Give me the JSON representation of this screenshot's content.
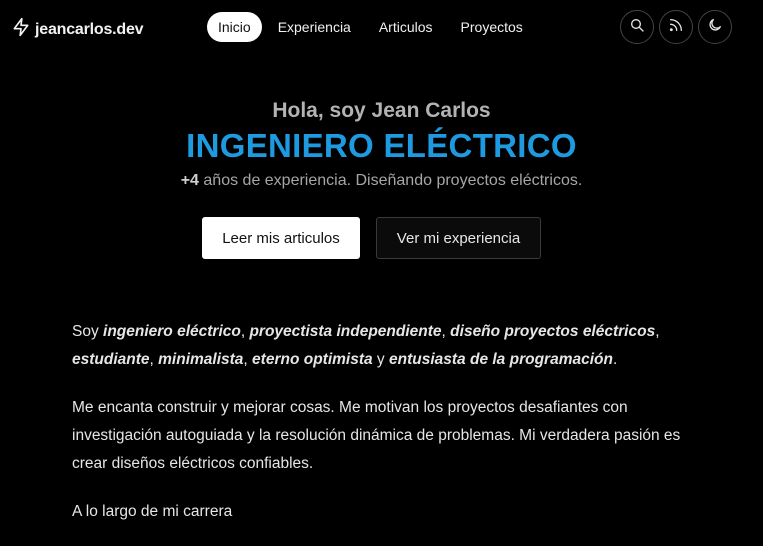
{
  "header": {
    "brand": "jeancarlos.dev",
    "nav": [
      {
        "label": "Inicio",
        "active": true
      },
      {
        "label": "Experiencia",
        "active": false
      },
      {
        "label": "Articulos",
        "active": false
      },
      {
        "label": "Proyectos",
        "active": false
      }
    ],
    "icons": [
      "search-icon",
      "rss-icon",
      "moon-icon"
    ]
  },
  "hero": {
    "greeting": "Hola, soy Jean Carlos",
    "title": "INGENIERO ELÉCTRICO",
    "sub_bold": "+4",
    "sub_rest": " años de experiencia. Diseñando proyectos eléctricos.",
    "primary_button": "Leer mis articulos",
    "secondary_button": "Ver mi experiencia"
  },
  "about": {
    "p1": {
      "t0": "Soy ",
      "e1": "ingeniero eléctrico",
      "t1": ", ",
      "e2": "proyectista independiente",
      "t2": ", ",
      "e3": "diseño proyectos eléctricos",
      "t3": ", ",
      "e4": "estudiante",
      "t4": ", ",
      "e5": "minimalista",
      "t5": ", ",
      "e6": "eterno optimista",
      "t6": " y ",
      "e7": "entusiasta de la programación",
      "t7": "."
    },
    "p2": "Me encanta construir y mejorar cosas. Me motivan los proyectos desafiantes con investigación autoguiada y la resolución dinámica de problemas. Mi verdadera pasión es crear diseños eléctricos confiables.",
    "p3": "A lo largo de mi carrera"
  },
  "colors": {
    "accent": "#1e9be0",
    "background": "#000000"
  }
}
